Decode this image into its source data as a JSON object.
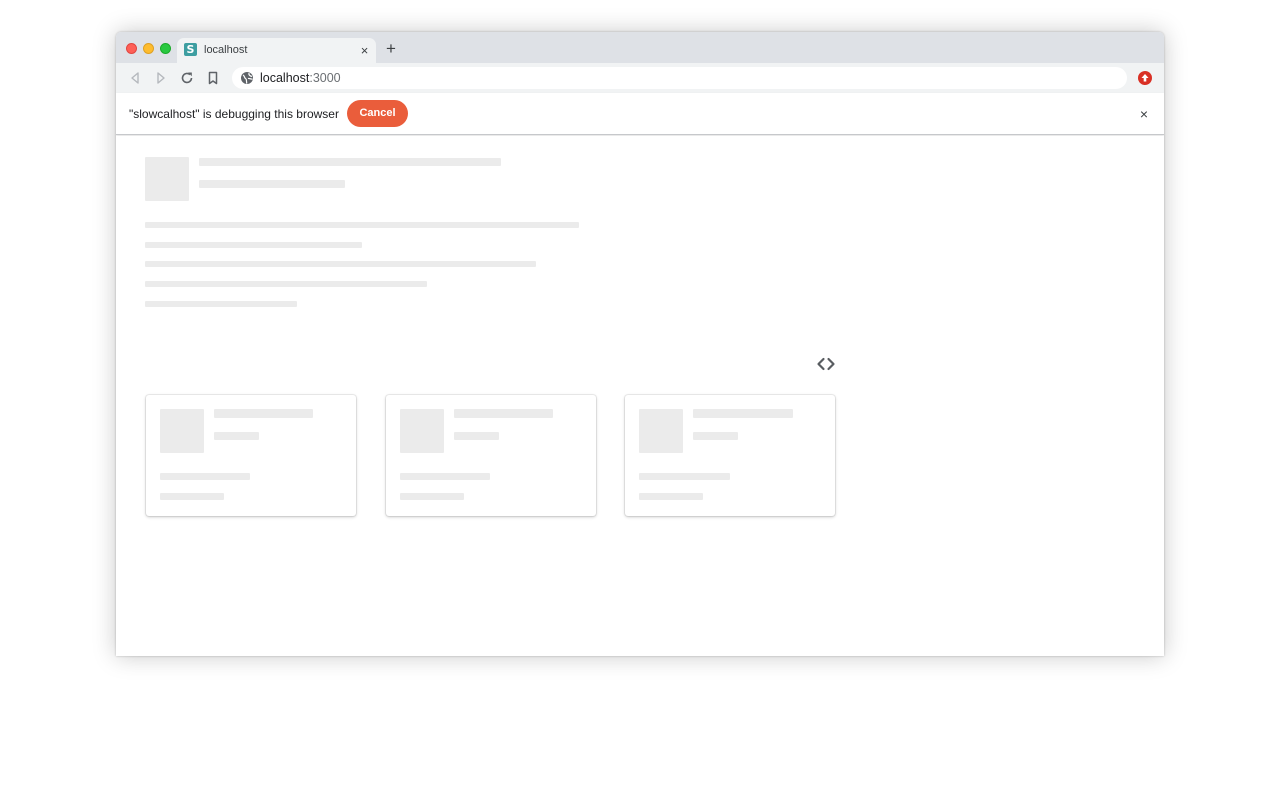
{
  "browser": {
    "tab": {
      "title": "localhost",
      "favicon_letter": "S",
      "favicon_color": "#3d9ea1",
      "close_glyph": "×"
    },
    "new_tab_glyph": "+",
    "address_bar": {
      "host": "localhost",
      "port": ":3000"
    },
    "toolbar_icons": [
      "back-icon",
      "forward-icon",
      "reload-icon",
      "bookmark-icon",
      "globe-icon",
      "extension-icon"
    ]
  },
  "infobar": {
    "message": "\"slowcalhost\" is debugging this browser",
    "cancel_label": "Cancel",
    "cancel_color": "#ea5d3b",
    "close_glyph": "×"
  },
  "page": {
    "state": "loading-skeleton",
    "skeleton_color": "#ebebeb",
    "card_count": 3,
    "toggle_icon": "code-icon"
  }
}
